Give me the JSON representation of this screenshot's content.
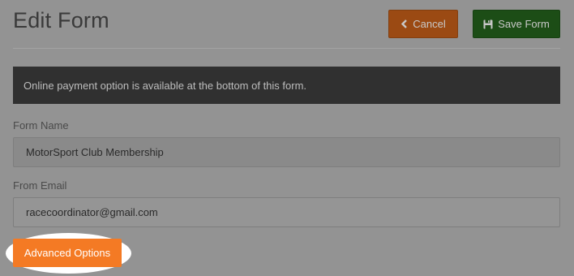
{
  "header": {
    "title": "Edit Form",
    "cancel_label": "Cancel",
    "save_label": "Save Form"
  },
  "notice": {
    "text": "Online payment option is available at the bottom of this form."
  },
  "form": {
    "name_label": "Form Name",
    "name_value": "MotorSport Club Membership",
    "email_label": "From Email",
    "email_value": "racecoordinator@gmail.com"
  },
  "advanced": {
    "label": "Advanced Options"
  },
  "icons": {
    "cancel": "chevron-left-icon",
    "save": "floppy-disk-icon"
  },
  "colors": {
    "cancel_button": "#9b4a13",
    "save_button": "#1c4d16",
    "advanced_button": "#f47a24",
    "notice_bg": "#303030"
  }
}
